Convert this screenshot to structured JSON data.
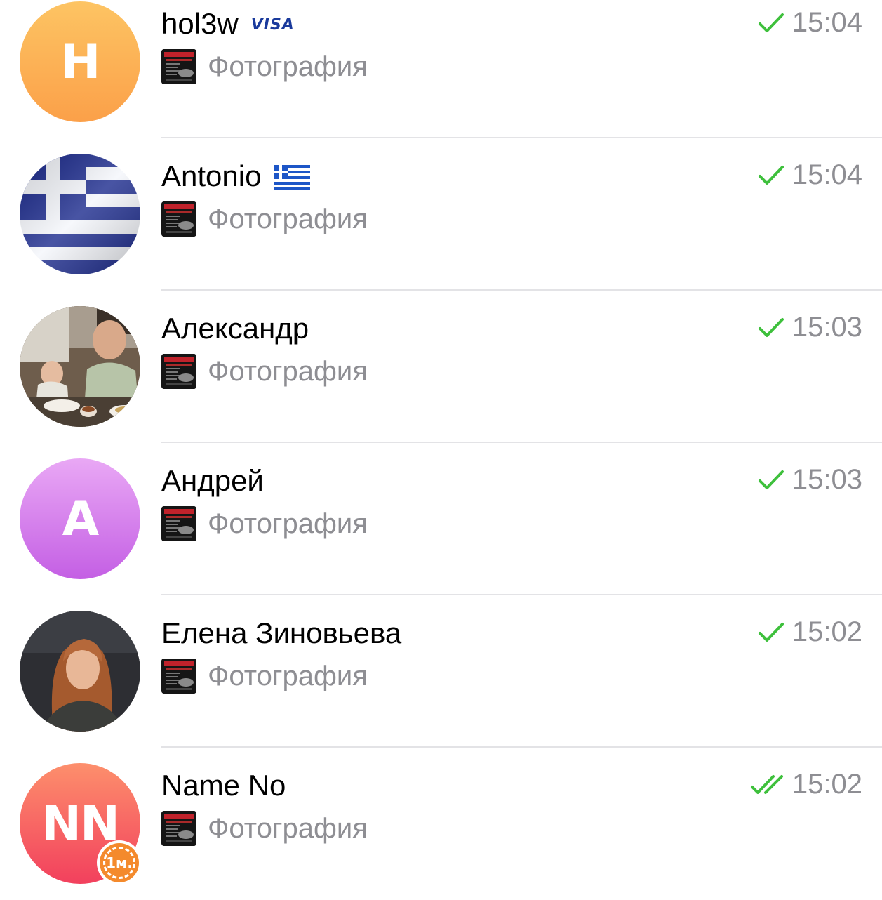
{
  "chats": [
    {
      "name": "hol3w",
      "badge": "VISA",
      "preview": "Фотография",
      "time": "15:04",
      "status": "sent",
      "avatar_initials": "H",
      "avatar_colors": [
        "#fdbf59",
        "#fba24a"
      ]
    },
    {
      "name": "Antonio",
      "badge_icon": "greece-flag-icon",
      "preview": "Фотография",
      "time": "15:04",
      "status": "sent",
      "avatar_icon": "greece-flag-photo"
    },
    {
      "name": "Александр",
      "preview": "Фотография",
      "time": "15:03",
      "status": "sent",
      "avatar_icon": "cafe-photo"
    },
    {
      "name": "Андрей",
      "preview": "Фотография",
      "time": "15:03",
      "status": "sent",
      "avatar_initials": "A",
      "avatar_colors": [
        "#e7a4f3",
        "#c763e6"
      ]
    },
    {
      "name": "Елена Зиновьева",
      "preview": "Фотография",
      "time": "15:02",
      "status": "sent",
      "avatar_icon": "portrait-photo"
    },
    {
      "name": "Name No",
      "preview": "Фотография",
      "time": "15:02",
      "status": "read",
      "avatar_initials": "NN",
      "avatar_colors": [
        "#fd8a6b",
        "#f2455e"
      ],
      "story_badge": "1м."
    }
  ],
  "colors": {
    "check": "#3ec03c",
    "time": "#8e8e93",
    "divider": "#e3e3e6"
  }
}
